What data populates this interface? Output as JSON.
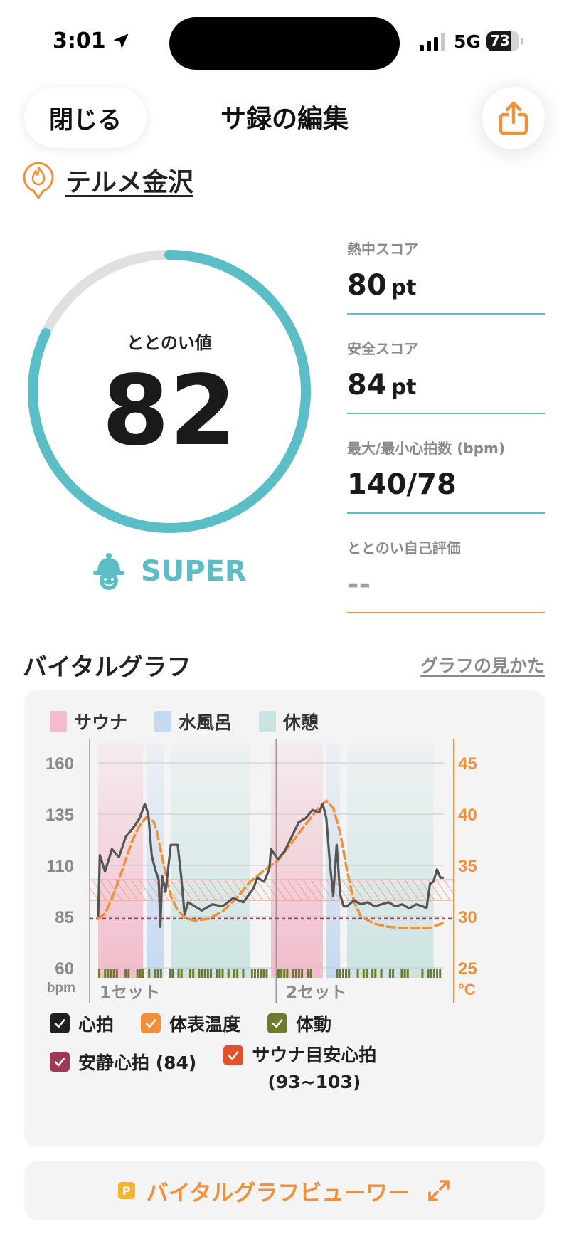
{
  "status_bar": {
    "time": "3:01",
    "network": "5G",
    "battery": "73",
    "battery_level": 0.73
  },
  "header": {
    "close_label": "閉じる",
    "title": "サ録の編集"
  },
  "facility": {
    "name": "テルメ金沢"
  },
  "score": {
    "label": "ととのい値",
    "value": "82",
    "progress": 0.82,
    "rank": "SUPER"
  },
  "metrics": [
    {
      "label": "熱中スコア",
      "value": "80",
      "unit": "pt"
    },
    {
      "label": "安全スコア",
      "value": "84",
      "unit": "pt"
    },
    {
      "label": "最大/最小心拍数 (bpm)",
      "value": "140/78",
      "unit": ""
    },
    {
      "label": "ととのい自己評価",
      "value": "--",
      "unit": ""
    }
  ],
  "vital": {
    "title": "バイタルグラフ",
    "howto_link": "グラフの見かた",
    "phase_legend": [
      {
        "label": "サウナ",
        "color": "#f2bccb"
      },
      {
        "label": "水風呂",
        "color": "#c5d9f1"
      },
      {
        "label": "休憩",
        "color": "#cbe4e2"
      }
    ],
    "checkboxes": [
      {
        "label": "心拍",
        "color": "#1f1f1f"
      },
      {
        "label": "体表温度",
        "color": "#f0913a"
      },
      {
        "label": "体動",
        "color": "#6e7a2e"
      },
      {
        "label": "安静心拍 (84)",
        "color": "#9c3a55"
      },
      {
        "label": "サウナ目安心拍",
        "label2": "(93~103)",
        "color": "#e0522a"
      }
    ]
  },
  "chart_data": {
    "type": "line",
    "left_axis": {
      "unit": "bpm",
      "ticks": [
        160,
        135,
        110,
        85,
        60
      ],
      "range": [
        60,
        160
      ]
    },
    "right_axis": {
      "unit": "°C",
      "ticks": [
        45,
        40,
        35,
        30,
        25
      ],
      "range": [
        25,
        45
      ]
    },
    "set_labels": [
      "1セット",
      "2セット"
    ],
    "resting_hr": 84,
    "sauna_target_hr": [
      93,
      103
    ],
    "phases": [
      {
        "type": "sauna",
        "start": 0,
        "end": 13
      },
      {
        "type": "cold_bath",
        "start": 14,
        "end": 19
      },
      {
        "type": "rest",
        "start": 21,
        "end": 44
      },
      {
        "type": "sauna",
        "start": 50,
        "end": 65
      },
      {
        "type": "cold_bath",
        "start": 66,
        "end": 70
      },
      {
        "type": "rest",
        "start": 72,
        "end": 97
      }
    ],
    "series": [
      {
        "name": "心拍",
        "axis": "left",
        "x": [
          0,
          0.5,
          2,
          4,
          6,
          8,
          10,
          12,
          13.5,
          14.5,
          15.5,
          16.5,
          17.5,
          18,
          18.5,
          19.5,
          21,
          23,
          24,
          25,
          26,
          28,
          30,
          33,
          36,
          39,
          42,
          45,
          46,
          48,
          49.5,
          50,
          52,
          54,
          56,
          58,
          60,
          62,
          64,
          65,
          66,
          67,
          68,
          69,
          70,
          71,
          72,
          74,
          76,
          78,
          80,
          82,
          84,
          86,
          88,
          90,
          92,
          94,
          95,
          96,
          97,
          98,
          99,
          100
        ],
        "values": [
          85,
          115,
          107,
          118,
          114,
          124,
          128,
          133,
          140,
          135,
          115,
          108,
          103,
          80,
          105,
          97,
          120,
          120,
          105,
          86,
          92,
          90,
          88,
          91,
          90,
          94,
          92,
          99,
          104,
          102,
          108,
          118,
          113,
          117,
          124,
          131,
          133,
          137,
          136,
          140,
          133,
          112,
          95,
          120,
          96,
          90,
          90,
          93,
          91,
          92,
          90,
          91,
          92,
          90,
          91,
          89,
          91,
          90,
          89,
          101,
          102,
          108,
          104,
          104
        ]
      },
      {
        "name": "体表温度",
        "axis": "right",
        "x": [
          0,
          2,
          4,
          6,
          8,
          10,
          12,
          14,
          16,
          17,
          19,
          21,
          23,
          25,
          28,
          32,
          36,
          40,
          44,
          48,
          52,
          56,
          60,
          64,
          66,
          68,
          70,
          72,
          74,
          76,
          80,
          84,
          88,
          92,
          96,
          100
        ],
        "values": [
          29.8,
          30.3,
          31.8,
          33.6,
          35.6,
          37.5,
          38.9,
          39.7,
          39.3,
          38.3,
          35,
          32,
          30.6,
          29.9,
          29.6,
          29.8,
          30.5,
          31.8,
          33.4,
          34.5,
          35.5,
          37.2,
          39,
          40.7,
          41.3,
          40.6,
          38.2,
          34.5,
          31.5,
          30,
          29.3,
          29,
          28.9,
          28.9,
          28.9,
          29.4
        ]
      }
    ]
  }
}
